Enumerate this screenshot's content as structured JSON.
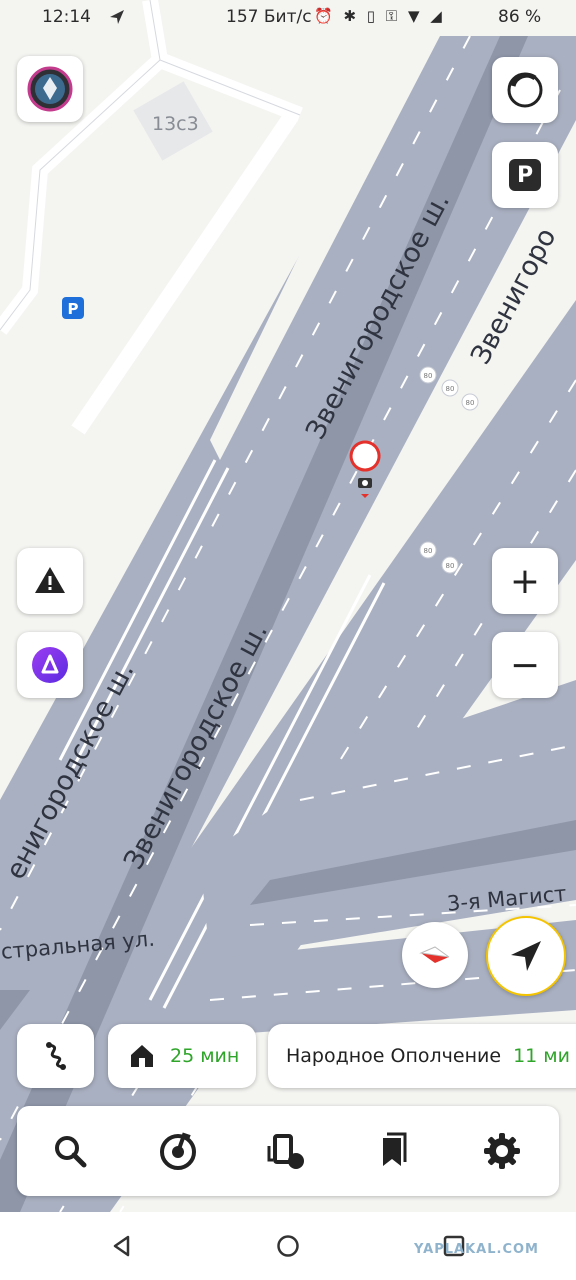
{
  "status_bar": {
    "time": "12:14",
    "speed": "157 Бит/с",
    "battery": "86 %",
    "icons": [
      "navigation-arrow-icon",
      "alarm-icon",
      "bluetooth-icon",
      "vibrate-icon",
      "key-icon",
      "wifi-icon",
      "signal-icon",
      "battery-icon"
    ]
  },
  "map": {
    "building_label": "13с3",
    "street_labels": {
      "upper_main": "Звенигородское ш.",
      "upper_right": "Звенигоро",
      "middle": "Звенигородское ш.",
      "left": "енигородское ш.",
      "lower_left": "стральная ул.",
      "right_road": "3-я Магист"
    },
    "speed_limits": [
      "80",
      "80",
      "80",
      "80",
      "80"
    ],
    "colors": {
      "road": "#a9b0c1",
      "road_dark": "#8e96a8",
      "ground": "#f4f4f1",
      "accent_yellow": "#f5c400"
    }
  },
  "controls": {
    "parking_label": "P",
    "parking_small_label": "P",
    "zoom_in": "+",
    "zoom_out": "−"
  },
  "route_chips": {
    "home_time": "25 мин",
    "destination_name": "Народное Ополчение",
    "destination_time": "11 ми"
  },
  "watermark": "YAPLAKAL.COM"
}
